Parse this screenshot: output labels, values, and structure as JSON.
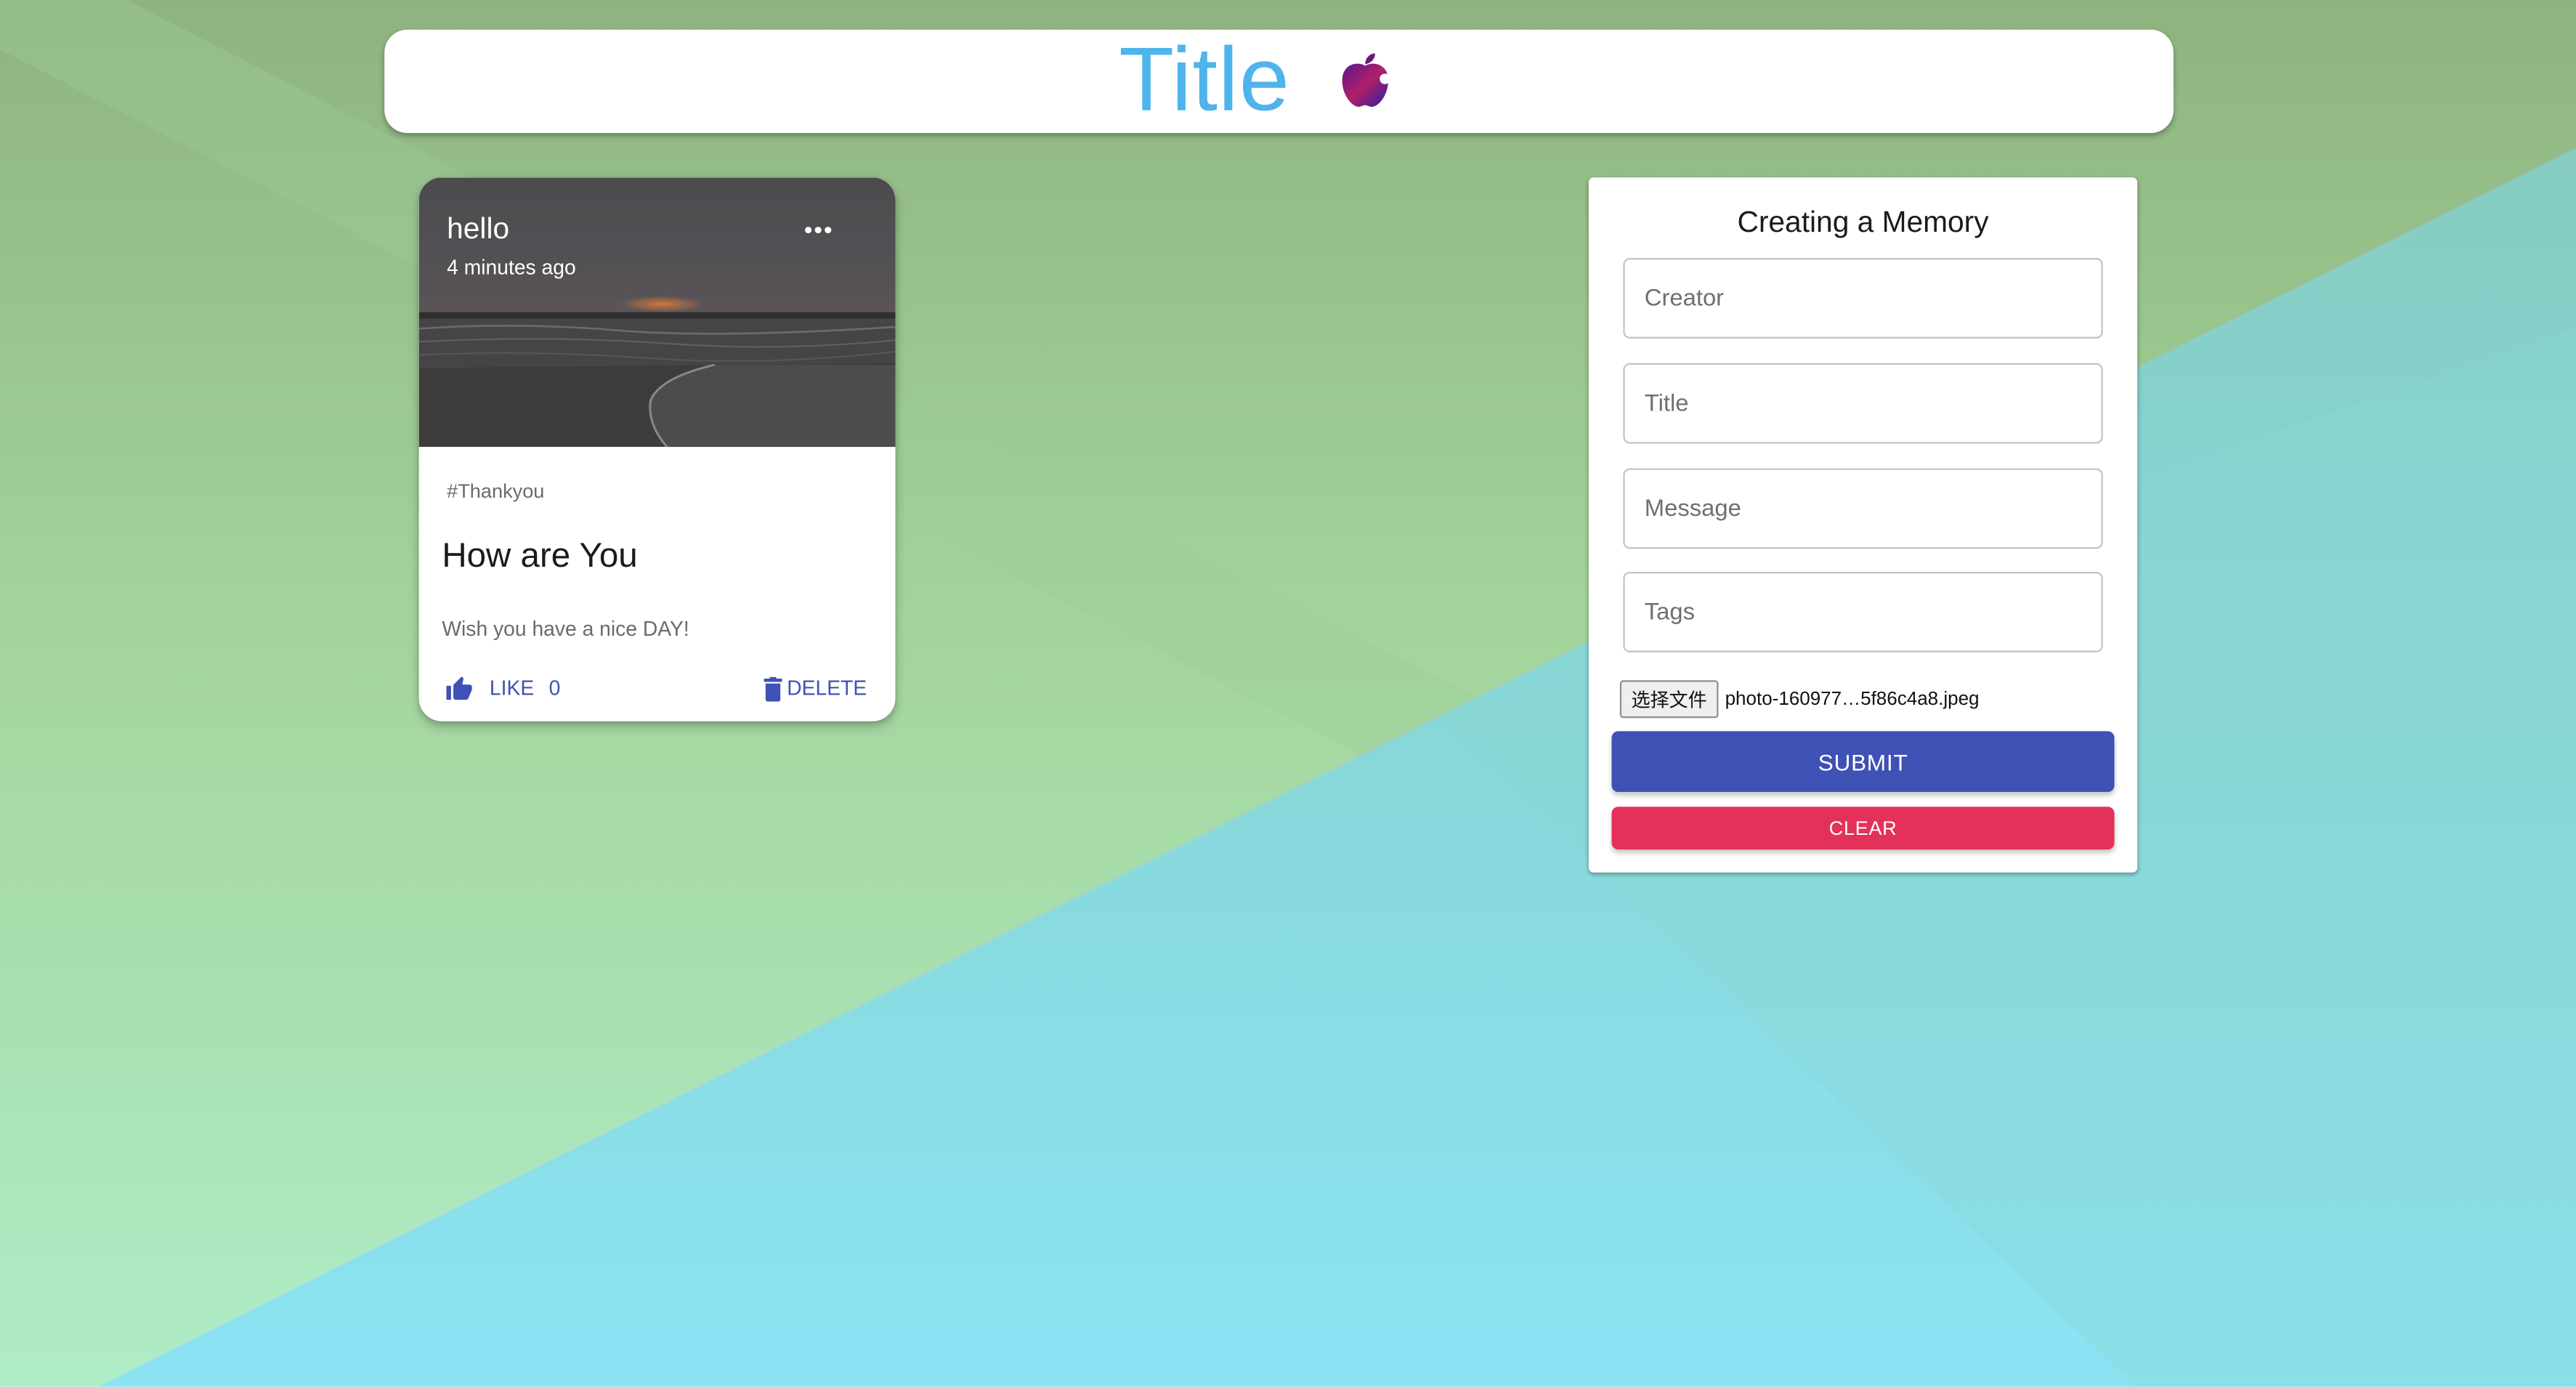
{
  "appbar": {
    "title": "Title",
    "logo_icon": "apple-logo-icon",
    "title_color": "#4fb3ec"
  },
  "post": {
    "creator": "hello",
    "time": "4 minutes ago",
    "more_icon": "more-horiz-icon",
    "tags": "#Thankyou",
    "title": "How are You",
    "message": "Wish you have a nice DAY!",
    "like_icon": "thumb-up-icon",
    "like_label": "LIKE",
    "like_count": "0",
    "delete_icon": "trash-icon",
    "delete_label": "DELETE",
    "accent_color": "#3f51b5"
  },
  "form": {
    "heading": "Creating a Memory",
    "fields": [
      {
        "placeholder": "Creator",
        "value": ""
      },
      {
        "placeholder": "Title",
        "value": ""
      },
      {
        "placeholder": "Message",
        "value": ""
      },
      {
        "placeholder": "Tags",
        "value": ""
      }
    ],
    "file_button_label": "选择文件",
    "file_name": "photo-160977…5f86c4a8.jpeg",
    "submit_label": "SUBMIT",
    "submit_color": "#3f51b5",
    "clear_label": "CLEAR",
    "clear_color": "#e3315a"
  }
}
